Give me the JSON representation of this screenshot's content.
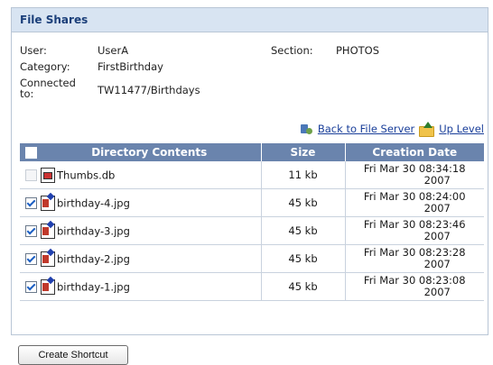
{
  "panel": {
    "title": "File Shares"
  },
  "info": {
    "user_label": "User:",
    "user_value": "UserA",
    "category_label": "Category:",
    "category_value": "FirstBirthday",
    "connected_label_line1": "Connected",
    "connected_label_line2": "to:",
    "connected_value": "TW11477/Birthdays",
    "section_label": "Section:",
    "section_value": "PHOTOS"
  },
  "links": {
    "back": "Back to File Server",
    "up": "Up Level"
  },
  "table": {
    "headers": [
      "Directory Contents",
      "Size",
      "Creation Date"
    ],
    "rows": [
      {
        "name": "Thumbs.db",
        "size": "11 kb",
        "date_line1": "Fri Mar 30 08:34:18",
        "date_line2": "2007",
        "checked": false,
        "icon": "database-file-icon"
      },
      {
        "name": "birthday-4.jpg",
        "size": "45 kb",
        "date_line1": "Fri Mar 30 08:24:00",
        "date_line2": "2007",
        "checked": true,
        "icon": "image-file-icon"
      },
      {
        "name": "birthday-3.jpg",
        "size": "45 kb",
        "date_line1": "Fri Mar 30 08:23:46",
        "date_line2": "2007",
        "checked": true,
        "icon": "image-file-icon"
      },
      {
        "name": "birthday-2.jpg",
        "size": "45 kb",
        "date_line1": "Fri Mar 30 08:23:28",
        "date_line2": "2007",
        "checked": true,
        "icon": "image-file-icon"
      },
      {
        "name": "birthday-1.jpg",
        "size": "45 kb",
        "date_line1": "Fri Mar 30 08:23:08",
        "date_line2": "2007",
        "checked": true,
        "icon": "image-file-icon"
      }
    ]
  },
  "footer": {
    "create_shortcut": "Create Shortcut"
  },
  "colors": {
    "header_bg": "#d8e4f2",
    "table_header_bg": "#6a84ad",
    "link": "#1a3f9a"
  }
}
